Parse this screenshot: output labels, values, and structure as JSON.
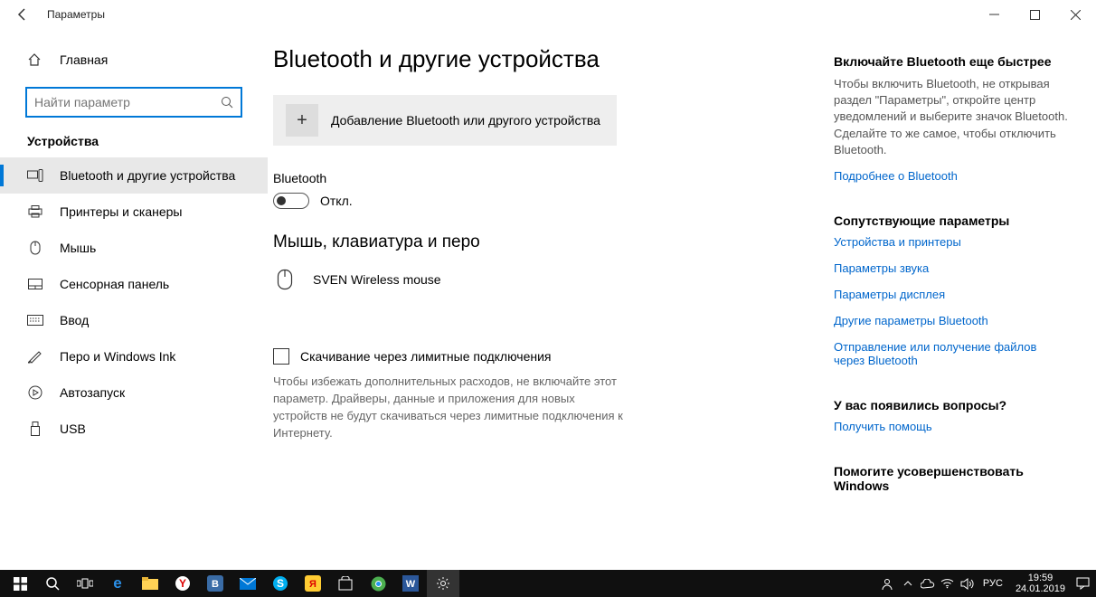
{
  "window": {
    "title": "Параметры"
  },
  "sidebar": {
    "home": "Главная",
    "search_placeholder": "Найти параметр",
    "category": "Устройства",
    "items": [
      {
        "label": "Bluetooth и другие устройства",
        "active": true
      },
      {
        "label": "Принтеры и сканеры"
      },
      {
        "label": "Мышь"
      },
      {
        "label": "Сенсорная панель"
      },
      {
        "label": "Ввод"
      },
      {
        "label": "Перо и Windows Ink"
      },
      {
        "label": "Автозапуск"
      },
      {
        "label": "USB"
      }
    ]
  },
  "main": {
    "title": "Bluetooth и другие устройства",
    "add_device": "Добавление Bluetooth или другого устройства",
    "bt_label": "Bluetooth",
    "bt_state": "Откл.",
    "mouse_head": "Мышь, клавиатура и перо",
    "device1": "SVEN Wireless mouse",
    "metered_label": "Скачивание через лимитные подключения",
    "metered_desc": "Чтобы избежать дополнительных расходов, не включайте этот параметр. Драйверы, данные и приложения для новых устройств не будут скачиваться через лимитные подключения к Интернету."
  },
  "right": {
    "tip_head": "Включайте Bluetooth еще быстрее",
    "tip_text": "Чтобы включить Bluetooth, не открывая раздел \"Параметры\", откройте центр уведомлений и выберите значок Bluetooth. Сделайте то же самое, чтобы отключить Bluetooth.",
    "link_more": "Подробнее о Bluetooth",
    "related_head": "Сопутствующие параметры",
    "links": {
      "a": "Устройства и принтеры",
      "b": "Параметры звука",
      "c": "Параметры дисплея",
      "d": "Другие параметры Bluetooth",
      "e": "Отправление или получение файлов через Bluetooth"
    },
    "q_head": "У вас появились вопросы?",
    "q_link": "Получить помощь",
    "improve_head": "Помогите усовершенствовать Windows"
  },
  "taskbar": {
    "lang": "РУС",
    "time": "19:59",
    "date": "24.01.2019"
  }
}
